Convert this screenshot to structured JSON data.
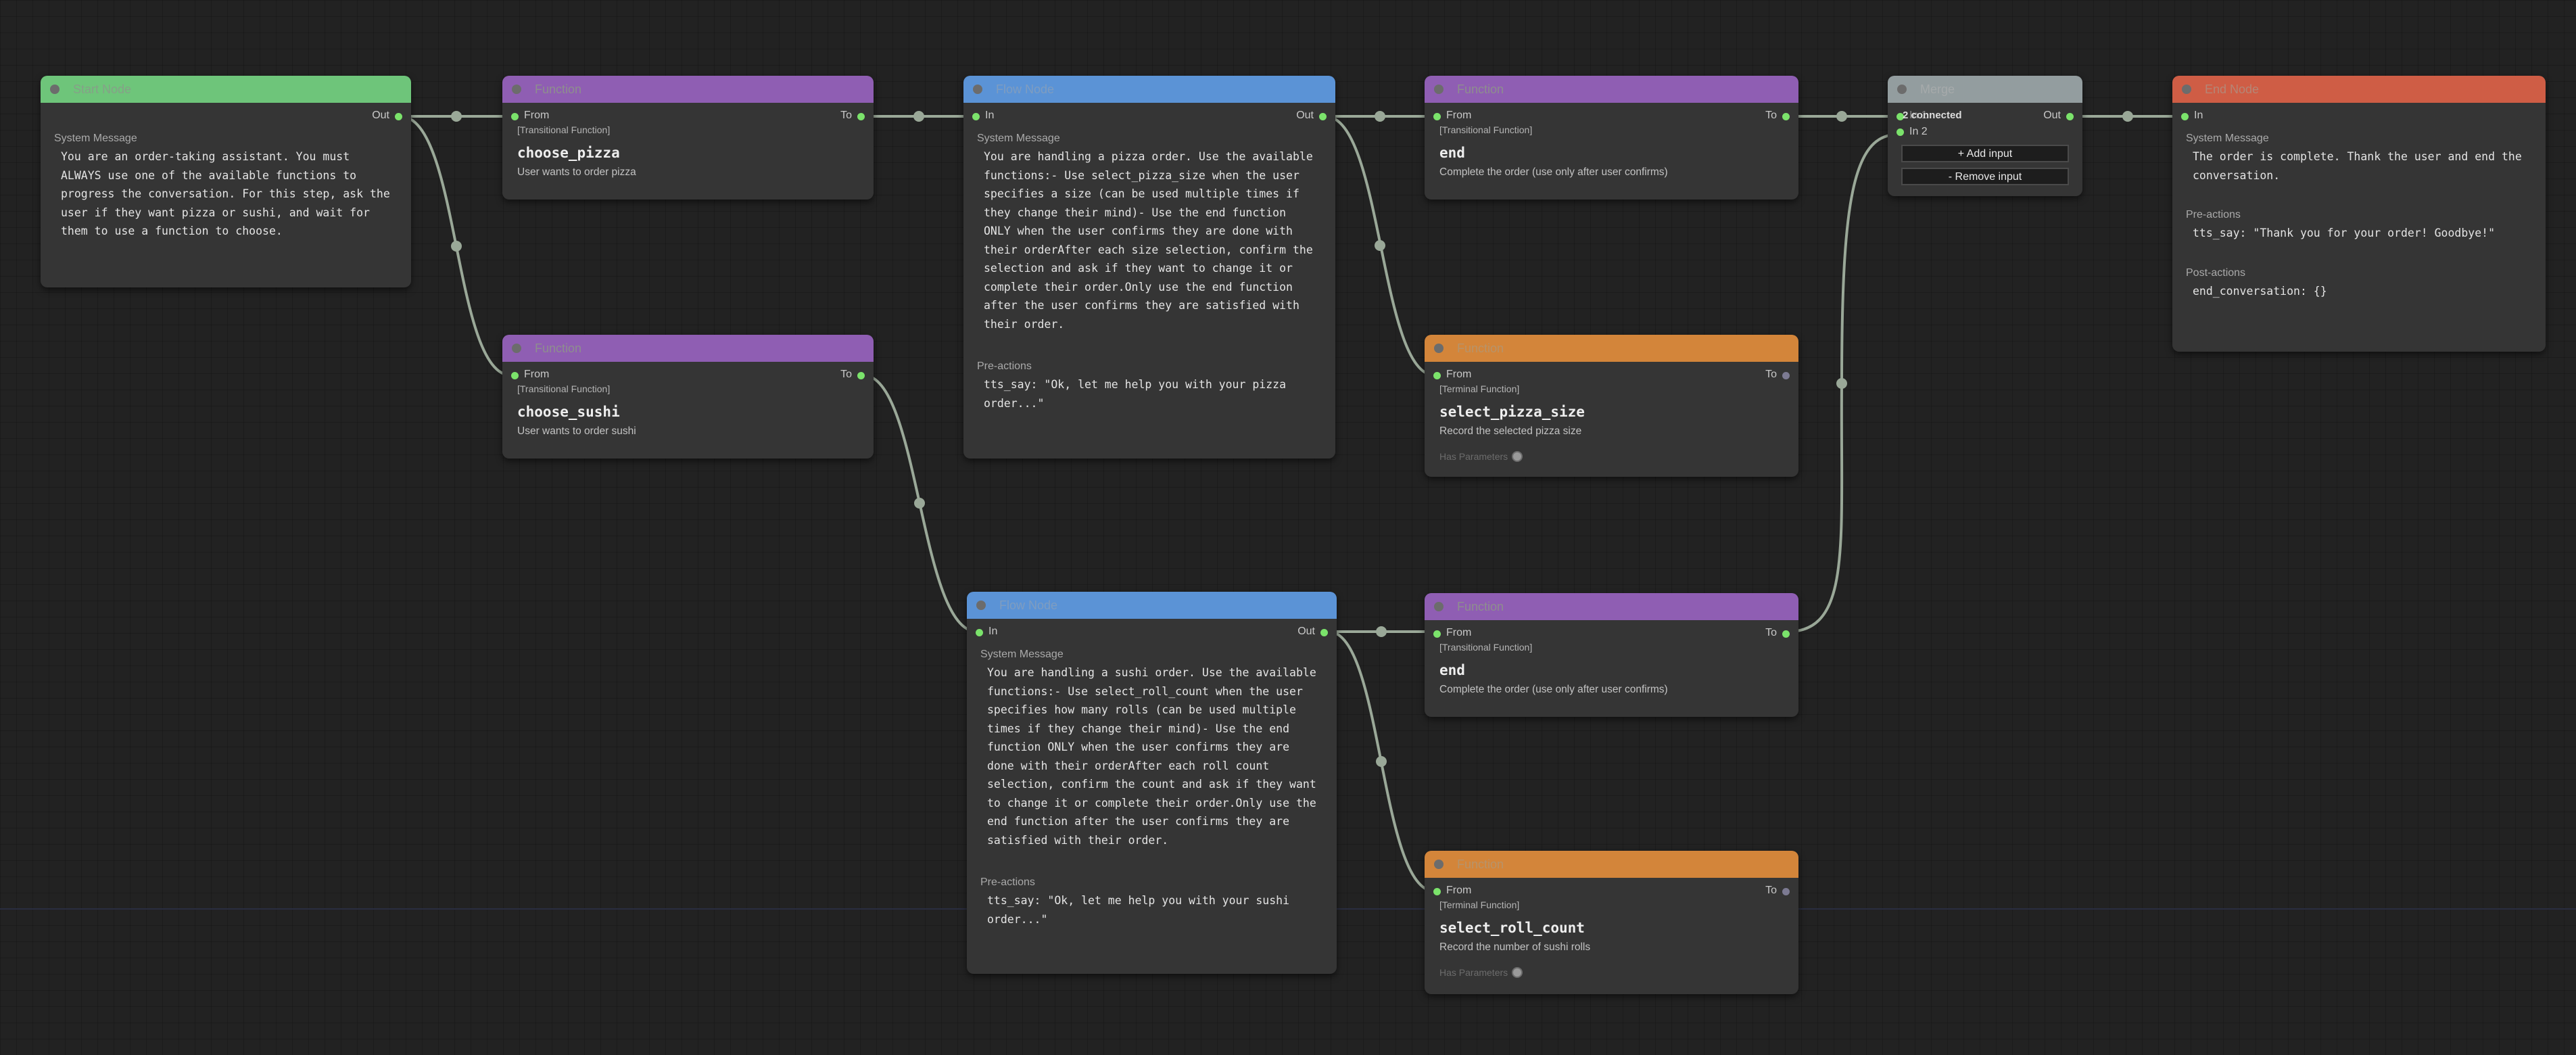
{
  "colors": {
    "port_active": "#7be36b",
    "port_inactive": "#7c7a92",
    "wire": "#9aa898",
    "start_header": "#6ec57a",
    "function_transitional_header": "#8f5eb3",
    "function_terminal_header": "#d3853a",
    "flow_header": "#5b93d6",
    "merge_header": "#939d9f",
    "end_header": "#cf5d45"
  },
  "start_node": {
    "title": "Start Node",
    "out_label": "Out",
    "system_message_label": "System Message",
    "system_message": "You are an order-taking assistant. You must ALWAYS use one of the available functions to progress the conversation. For this step, ask the user if they want pizza or sushi, and wait for them to use a function to choose."
  },
  "fn_choose_pizza": {
    "title": "Function",
    "from_label": "From",
    "to_label": "To",
    "kind": "[Transitional Function]",
    "name": "choose_pizza",
    "description": "User wants to order pizza"
  },
  "fn_choose_sushi": {
    "title": "Function",
    "from_label": "From",
    "to_label": "To",
    "kind": "[Transitional Function]",
    "name": "choose_sushi",
    "description": "User wants to order sushi"
  },
  "flow_pizza": {
    "title": "Flow Node",
    "in_label": "In",
    "out_label": "Out",
    "system_message_label": "System Message",
    "system_message": "You are handling a pizza order. Use the available functions:- Use select_pizza_size when the user specifies a size (can be used multiple times if they change their mind)- Use the end function ONLY when the user confirms they are done with their orderAfter each size selection, confirm the selection and ask if they want to change it or complete their order.Only use the end function after the user confirms they are satisfied with their order.",
    "pre_actions_label": "Pre-actions",
    "pre_actions": "tts_say: \"Ok, let me help you with your pizza order...\""
  },
  "flow_sushi": {
    "title": "Flow Node",
    "in_label": "In",
    "out_label": "Out",
    "system_message_label": "System Message",
    "system_message": "You are handling a sushi order. Use the available functions:- Use select_roll_count when the user specifies how many rolls (can be used multiple times if they change their mind)- Use the end function ONLY when the user confirms they are done with their orderAfter each roll count selection, confirm the count and ask if they want to change it or complete their order.Only use the end function after the user confirms they are satisfied with their order.",
    "pre_actions_label": "Pre-actions",
    "pre_actions": "tts_say: \"Ok, let me help you with your sushi order...\""
  },
  "fn_end_pizza": {
    "title": "Function",
    "from_label": "From",
    "to_label": "To",
    "kind": "[Transitional Function]",
    "name": "end",
    "description": "Complete the order (use only after user confirms)"
  },
  "fn_select_pizza_size": {
    "title": "Function",
    "from_label": "From",
    "to_label": "To",
    "kind": "[Terminal Function]",
    "name": "select_pizza_size",
    "description": "Record the selected pizza size",
    "params_label": "Has Parameters"
  },
  "fn_end_sushi": {
    "title": "Function",
    "from_label": "From",
    "to_label": "To",
    "kind": "[Transitional Function]",
    "name": "end",
    "description": "Complete the order (use only after user confirms)"
  },
  "fn_select_roll_count": {
    "title": "Function",
    "from_label": "From",
    "to_label": "To",
    "kind": "[Terminal Function]",
    "name": "select_roll_count",
    "description": "Record the number of sushi rolls",
    "params_label": "Has Parameters"
  },
  "merge_node": {
    "title": "Merge",
    "in1_label": "In 1",
    "connected_status": "2 connected",
    "in2_label": "In 2",
    "out_label": "Out",
    "add_input_label": "+ Add input",
    "remove_input_label": "- Remove input"
  },
  "end_node": {
    "title": "End Node",
    "in_label": "In",
    "system_message_label": "System Message",
    "system_message": "The order is complete. Thank the user and end the conversation.",
    "pre_actions_label": "Pre-actions",
    "pre_actions": "tts_say: \"Thank you for your order! Goodbye!\"",
    "post_actions_label": "Post-actions",
    "post_actions": "end_conversation: {}"
  }
}
